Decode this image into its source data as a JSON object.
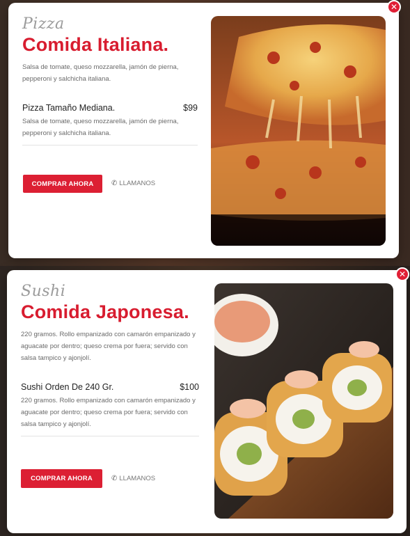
{
  "cards": [
    {
      "kicker": "Pizza",
      "title": "Comida Italiana.",
      "description": "Salsa de tomate, queso mozzarella, jamón de pierna, pepperoni y salchicha italiana.",
      "item_name": "Pizza Tamaño Mediana.",
      "item_price": "$99",
      "item_description": "Salsa de tomate, queso mozzarella, jamón de pierna, pepperoni y salchicha italiana.",
      "buy_label": "COMPRAR AHORA",
      "call_label": "LLAMANOS",
      "close_label": "✕"
    },
    {
      "kicker": "Sushi",
      "title": "Comida Japonesa.",
      "description": "220 gramos. Rollo empanizado con camarón empanizado y aguacate por dentro; queso crema por fuera; servido con salsa tampico y ajonjolí.",
      "item_name": "Sushi Orden De 240 Gr.",
      "item_price": "$100",
      "item_description": "220 gramos. Rollo empanizado con camarón empanizado y aguacate por dentro; queso crema por fuera; servido con salsa tampico y ajonjolí.",
      "buy_label": "COMPRAR AHORA",
      "call_label": "LLAMANOS",
      "close_label": "✕"
    }
  ],
  "icons": {
    "close": "close-icon",
    "phone": "phone-icon"
  },
  "colors": {
    "accent": "#dc1f33",
    "title": "#d81c2f"
  }
}
